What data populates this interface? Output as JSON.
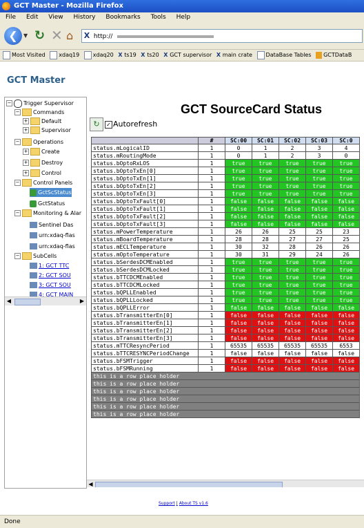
{
  "window": {
    "title": "GCT Master - Mozilla Firefox"
  },
  "menu": [
    "File",
    "Edit",
    "View",
    "History",
    "Bookmarks",
    "Tools",
    "Help"
  ],
  "nav": {
    "url": "http://"
  },
  "bookmarks": [
    "Most Visited",
    "xdaq19",
    "xdaq20",
    "ts19",
    "ts20",
    "GCT supervisor",
    "main crate",
    "DataBase Tables",
    "GCTDataB"
  ],
  "page": {
    "heading": "GCT Master"
  },
  "tree": {
    "nodes": [
      {
        "label": "Trigger Supervisor"
      },
      {
        "label": "Commands"
      },
      {
        "label": "Default"
      },
      {
        "label": "Supervisor"
      },
      {
        "label": "Operations"
      },
      {
        "label": "Create"
      },
      {
        "label": "Destroy"
      },
      {
        "label": "Control"
      },
      {
        "label": "Control Panels"
      },
      {
        "label": "GctScStatus"
      },
      {
        "label": "GctStatus"
      },
      {
        "label": "Monitoring & Alar"
      },
      {
        "label": "Sentinel Das"
      },
      {
        "label": "urn:xdaq-flas"
      },
      {
        "label": "urn:xdaq-flas"
      },
      {
        "label": "SubCells"
      },
      {
        "label": "1: GCT TTC"
      },
      {
        "label": "2: GCT SOU"
      },
      {
        "label": "3: GCT SOU"
      },
      {
        "label": "4: GCT MAIN"
      }
    ]
  },
  "panel": {
    "title": "GCT SourceCard Status",
    "autorefresh_label": "Autorefresh",
    "autorefresh_check": "✓",
    "columns": [
      "#",
      "SC:00",
      "SC:01",
      "SC:02",
      "SC:03",
      "SC:0"
    ],
    "rows": [
      {
        "name": "status.mLogicalID",
        "hash": "1",
        "cells": [
          "0",
          "1",
          "2",
          "3",
          "4"
        ],
        "color": ""
      },
      {
        "name": "status.mRoutingMode",
        "hash": "1",
        "cells": [
          "0",
          "1",
          "2",
          "3",
          "0"
        ],
        "color": ""
      },
      {
        "name": "status.bOptoRxLOS",
        "hash": "1",
        "cells": [
          "true",
          "true",
          "true",
          "true",
          "true"
        ],
        "color": "g"
      },
      {
        "name": "status.bOptoTxEn[0]",
        "hash": "1",
        "cells": [
          "true",
          "true",
          "true",
          "true",
          "true"
        ],
        "color": "g"
      },
      {
        "name": "status.bOptoTxEn[1]",
        "hash": "1",
        "cells": [
          "true",
          "true",
          "true",
          "true",
          "true"
        ],
        "color": "g"
      },
      {
        "name": "status.bOptoTxEn[2]",
        "hash": "1",
        "cells": [
          "true",
          "true",
          "true",
          "true",
          "true"
        ],
        "color": "g"
      },
      {
        "name": "status.bOptoTxEn[3]",
        "hash": "1",
        "cells": [
          "true",
          "true",
          "true",
          "true",
          "true"
        ],
        "color": "g"
      },
      {
        "name": "status.bOptoTxFault[0]",
        "hash": "1",
        "cells": [
          "false",
          "false",
          "false",
          "false",
          "false"
        ],
        "color": "g"
      },
      {
        "name": "status.bOptoTxFault[1]",
        "hash": "1",
        "cells": [
          "false",
          "false",
          "false",
          "false",
          "false"
        ],
        "color": "g"
      },
      {
        "name": "status.bOptoTxFault[2]",
        "hash": "1",
        "cells": [
          "false",
          "false",
          "false",
          "false",
          "false"
        ],
        "color": "g"
      },
      {
        "name": "status.bOptoTxFault[3]",
        "hash": "1",
        "cells": [
          "false",
          "false",
          "false",
          "false",
          "false"
        ],
        "color": "g"
      },
      {
        "name": "status.mPowerTemperature",
        "hash": "1",
        "cells": [
          "26",
          "26",
          "25",
          "25",
          "23"
        ],
        "color": ""
      },
      {
        "name": "status.mBoardTemperature",
        "hash": "1",
        "cells": [
          "28",
          "28",
          "27",
          "27",
          "25"
        ],
        "color": ""
      },
      {
        "name": "status.mECLTemperature",
        "hash": "1",
        "cells": [
          "30",
          "32",
          "28",
          "26",
          "26"
        ],
        "color": ""
      },
      {
        "name": "status.mOptoTemperature",
        "hash": "1",
        "cells": [
          "30",
          "31",
          "29",
          "24",
          "26"
        ],
        "color": ""
      },
      {
        "name": "status.bSerdesDCMEnabled",
        "hash": "1",
        "cells": [
          "true",
          "true",
          "true",
          "true",
          "true"
        ],
        "color": "g"
      },
      {
        "name": "status.bSerdesDCMLocked",
        "hash": "1",
        "cells": [
          "true",
          "true",
          "true",
          "true",
          "true"
        ],
        "color": "g"
      },
      {
        "name": "status.bTTCDCMEnabled",
        "hash": "1",
        "cells": [
          "true",
          "true",
          "true",
          "true",
          "true"
        ],
        "color": "g"
      },
      {
        "name": "status.bTTCDCMLocked",
        "hash": "1",
        "cells": [
          "true",
          "true",
          "true",
          "true",
          "true"
        ],
        "color": "g"
      },
      {
        "name": "status.bQPLLEnabled",
        "hash": "1",
        "cells": [
          "true",
          "true",
          "true",
          "true",
          "true"
        ],
        "color": "g"
      },
      {
        "name": "status.bQPLLLocked",
        "hash": "1",
        "cells": [
          "true",
          "true",
          "true",
          "true",
          "true"
        ],
        "color": "g"
      },
      {
        "name": "status.bQPLLError",
        "hash": "1",
        "cells": [
          "false",
          "false",
          "false",
          "false",
          "false"
        ],
        "color": "g"
      },
      {
        "name": "status.bTransmitterEn[0]",
        "hash": "1",
        "cells": [
          "false",
          "false",
          "false",
          "false",
          "false"
        ],
        "color": "r"
      },
      {
        "name": "status.bTransmitterEn[1]",
        "hash": "1",
        "cells": [
          "false",
          "false",
          "false",
          "false",
          "false"
        ],
        "color": "r"
      },
      {
        "name": "status.bTransmitterEn[2]",
        "hash": "1",
        "cells": [
          "false",
          "false",
          "false",
          "false",
          "false"
        ],
        "color": "r"
      },
      {
        "name": "status.bTransmitterEn[3]",
        "hash": "1",
        "cells": [
          "false",
          "false",
          "false",
          "false",
          "false"
        ],
        "color": "r"
      },
      {
        "name": "status.mTTCResyncPeriod",
        "hash": "1",
        "cells": [
          "65535",
          "65535",
          "65535",
          "65535",
          "6553"
        ],
        "color": ""
      },
      {
        "name": "status.bTTCRESYNCPeriodChange",
        "hash": "1",
        "cells": [
          "false",
          "false",
          "false",
          "false",
          "false"
        ],
        "color": ""
      },
      {
        "name": "status.bFSMTrigger",
        "hash": "1",
        "cells": [
          "false",
          "false",
          "false",
          "false",
          "false"
        ],
        "color": "r"
      },
      {
        "name": "status.bFSMRunning",
        "hash": "1",
        "cells": [
          "false",
          "false",
          "false",
          "false",
          "false"
        ],
        "color": "r"
      }
    ],
    "placeholder_rows": [
      "this is a row place holder",
      "this is a row place holder",
      "this is a row place holder",
      "this is a row place holder",
      "this is a row place holder",
      "this is a row place holder"
    ]
  },
  "footer": {
    "support": "Support",
    "about": "About TS v1.6"
  },
  "status": {
    "text": "Done"
  },
  "colors": {
    "true_bg": "#22c522",
    "false_bg": "#dd1111",
    "placeholder_bg": "#808080",
    "heading": "#2b5f8a"
  }
}
